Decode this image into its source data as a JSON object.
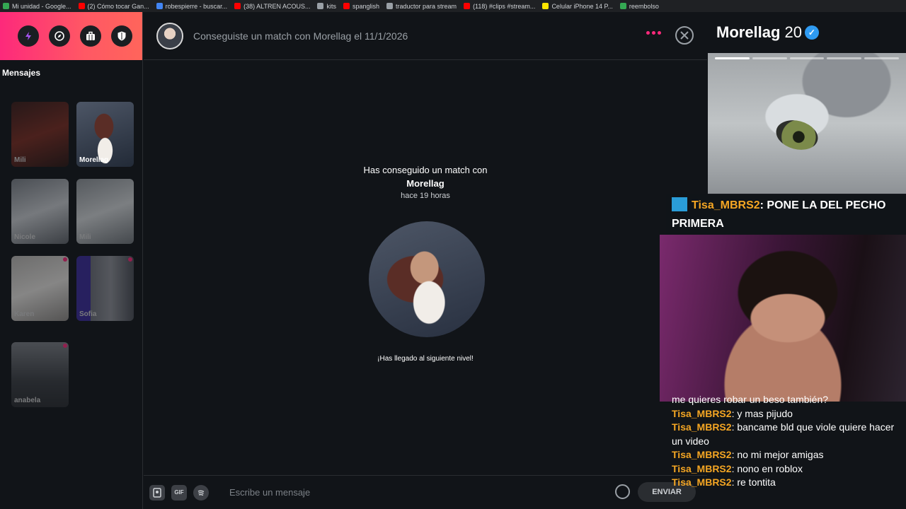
{
  "bookmarks": [
    {
      "label": "Mi unidad - Google...",
      "color": "#34a853"
    },
    {
      "label": "(2) Cómo tocar Gan...",
      "color": "#ff0000"
    },
    {
      "label": "robespierre - buscar...",
      "color": "#4285f4"
    },
    {
      "label": "(38) ALTREN ACOUS...",
      "color": "#ff0000"
    },
    {
      "label": "kits",
      "color": "#9aa0a6"
    },
    {
      "label": "spanglish",
      "color": "#ff0000"
    },
    {
      "label": "traductor para stream",
      "color": "#9aa0a6"
    },
    {
      "label": "(118) #clips #stream...",
      "color": "#ff0000"
    },
    {
      "label": "Celular iPhone 14 P...",
      "color": "#ffe600"
    },
    {
      "label": "reembolso",
      "color": "#34a853"
    }
  ],
  "sidebar": {
    "title": "Mensajes",
    "nav_icons": [
      "bolt-icon",
      "compass-icon",
      "briefcase-icon",
      "shield-icon"
    ],
    "matches": [
      {
        "name": "Mili",
        "dim": true,
        "dot": false
      },
      {
        "name": "Morellag",
        "dim": false,
        "dot": false
      },
      {
        "name": "Nicole",
        "dim": true,
        "dot": false
      },
      {
        "name": "Mili",
        "dim": true,
        "dot": false
      },
      {
        "name": "Karen",
        "dim": true,
        "dot": true
      },
      {
        "name": "Sofia",
        "dim": true,
        "dot": true
      },
      {
        "name": "anabela",
        "dim": true,
        "dot": true
      }
    ]
  },
  "chat": {
    "header_text": "Conseguiste un match con Morellag el 11/1/2026",
    "match_title": "Has conseguido un match con",
    "match_name": "Morellag",
    "match_time": "hace 19 horas",
    "level_text": "¡Has llegado al siguiente nivel!",
    "composer": {
      "gif_label": "GIF",
      "placeholder": "Escribe un mensaje",
      "send_label": "ENVIAR"
    }
  },
  "profile": {
    "name": "Morellag",
    "age": "20",
    "verified_icon": "verified-badge-icon"
  },
  "stream_overlay": {
    "highlight": {
      "user": "Tisa_MBRS2",
      "text": "PONE LA DEL PECHO PRIMERA"
    },
    "chat": [
      {
        "user": "",
        "text": "me quieres robar un beso también?"
      },
      {
        "user": "Tisa_MBRS2",
        "text": "y mas pijudo"
      },
      {
        "user": "Tisa_MBRS2",
        "text": "bancame bld que viole quiere hacer un video"
      },
      {
        "user": "Tisa_MBRS2",
        "text": "no mi mejor amigas"
      },
      {
        "user": "Tisa_MBRS2",
        "text": "nono en roblox"
      },
      {
        "user": "Tisa_MBRS2",
        "text": "re tontita"
      }
    ]
  },
  "colors": {
    "brand_gradient_start": "#fd297b",
    "brand_gradient_end": "#ff655b",
    "username": "#f5a623",
    "verified": "#2f9bf2"
  }
}
